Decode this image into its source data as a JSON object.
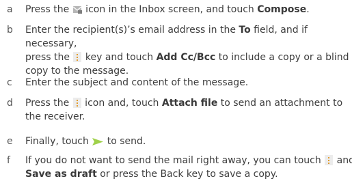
{
  "steps": [
    {
      "marker": "a",
      "t1": "Press the ",
      "icon": "compose-icon",
      "t2": " icon in the Inbox screen, and touch ",
      "b1": "Compose",
      "t3": "."
    },
    {
      "marker": "b",
      "t1": "Enter the recipient(s)’s email address in the ",
      "b1": "To",
      "t2": " field, and if necessary,",
      "t3": "press  the ",
      "icon": "menu-key-icon",
      "t4": " key and touch ",
      "b2": "Add Cc/Bcc",
      "t5": " to include a copy or a blind",
      "t6": "copy to the message."
    },
    {
      "marker": "c",
      "t1": "Enter the subject and content of the message."
    },
    {
      "marker": "d",
      "t1": "Press the ",
      "icon": "menu-key-icon",
      "t2": " icon and, touch ",
      "b1": "Attach file",
      "t3": " to send an attachment to",
      "t4": "the receiver."
    },
    {
      "marker": "e",
      "t1": "Finally, touch ",
      "icon": "send-icon",
      "t2": " to send."
    },
    {
      "marker": "f",
      "t1": "If you do not want to send the mail right away, you can touch ",
      "icon": "menu-key-icon",
      "t2": " and",
      "b1": "Save as draft",
      "t3": " or press the Back key to save a copy."
    }
  ],
  "colors": {
    "text": "#3d3d3d",
    "icon_gray": "#b7b7b7",
    "accent_orange": "#e39b2a",
    "send_green": "#9fd14a"
  }
}
